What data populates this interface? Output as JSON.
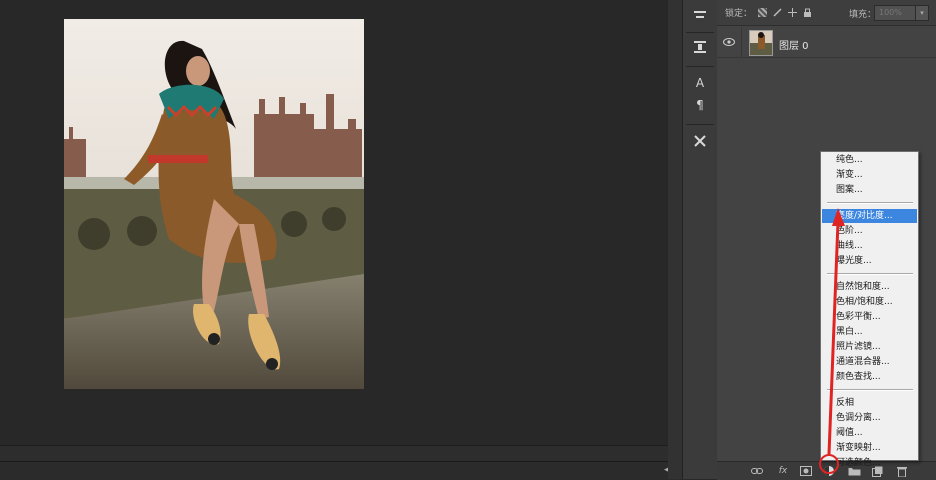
{
  "lock_row": {
    "label": "锁定：",
    "fill_label": "填充：",
    "fill_value": "100%"
  },
  "layers": [
    {
      "name": "图层 0",
      "visible": true
    }
  ],
  "status_menu_icon": "panel-menu-icon",
  "tools": [
    "brush-preset-icon",
    "clone-source-icon",
    "character-icon",
    "paragraph-icon",
    "tool-preset-icon"
  ],
  "tool_glyphs": {
    "character": "A",
    "paragraph": "¶"
  },
  "footer_icons": [
    "link-layers-icon",
    "fx-icon",
    "layer-mask-icon",
    "adjustment-layer-icon",
    "new-group-icon",
    "new-layer-icon",
    "delete-icon"
  ],
  "footer_fx_label": "fx",
  "adjustment_menu": {
    "groups": [
      [
        "纯色...",
        "渐变...",
        "图案..."
      ],
      [
        "亮度/对比度...",
        "色阶...",
        "曲线...",
        "曝光度..."
      ],
      [
        "自然饱和度...",
        "色相/饱和度...",
        "色彩平衡...",
        "黑白...",
        "照片滤镜...",
        "通道混合器...",
        "颜色查找..."
      ],
      [
        "反相",
        "色调分离...",
        "阈值...",
        "渐变映射...",
        "可选颜色..."
      ]
    ],
    "selected": "亮度/对比度..."
  },
  "colors": {
    "menu_highlight": "#3c86e0",
    "annotation_red": "#e02424"
  }
}
